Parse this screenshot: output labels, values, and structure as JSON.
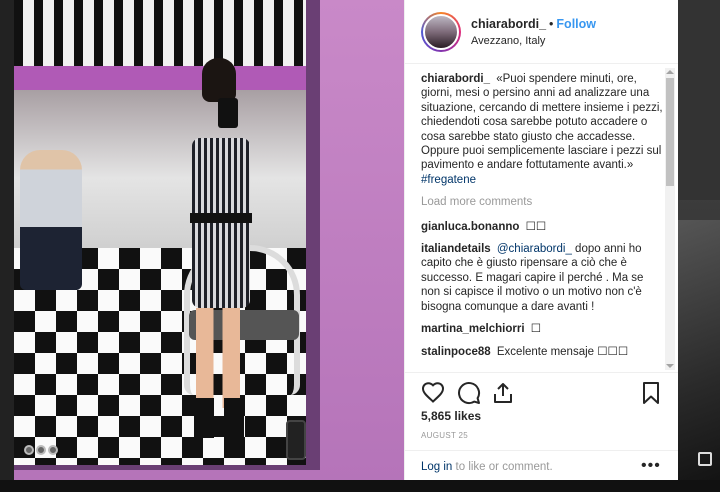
{
  "post": {
    "username": "chiarabordi_",
    "separator": "•",
    "follow_label": "Follow",
    "location": "Avezzano, Italy"
  },
  "caption": {
    "username": "chiarabordi_",
    "text": "«Puoi spendere minuti, ore, giorni, mesi o persino anni ad analizzare una situazione, cercando di mettere insieme i pezzi, chiedendoti cosa sarebbe potuto accadere o cosa sarebbe stato giusto che accadesse. Oppure puoi semplicemente lasciare i pezzi sul pavimento e andare fottutamente avanti.»",
    "hashtag": "#fregatene"
  },
  "load_more_label": "Load more comments",
  "comments": [
    {
      "username": "gianluca.bonanno",
      "text": "☐☐"
    },
    {
      "username": "italiandetails",
      "mention": "@chiarabordi_",
      "text": "dopo anni ho capito che è giusto ripensare a ciò che è successo. E magari capire il perché . Ma se non si capisce il motivo o un motivo non c'è bisogna comunque a dare avanti !"
    },
    {
      "username": "martina_melchiorri",
      "text": "☐"
    },
    {
      "username": "stalinpoce88",
      "text": "Excelente mensaje ☐☐☐"
    }
  ],
  "actions": {
    "icons": [
      "heart-icon",
      "comment-icon",
      "share-icon",
      "bookmark-icon"
    ]
  },
  "likes": "5,865 likes",
  "date": "AUGUST 25",
  "footer": {
    "login_label": "Log in",
    "login_suffix": " to like or comment.",
    "more_label": "•••"
  },
  "colors": {
    "link": "#3897f0",
    "hashtag": "#003569",
    "muted": "#999999",
    "text": "#262626"
  }
}
